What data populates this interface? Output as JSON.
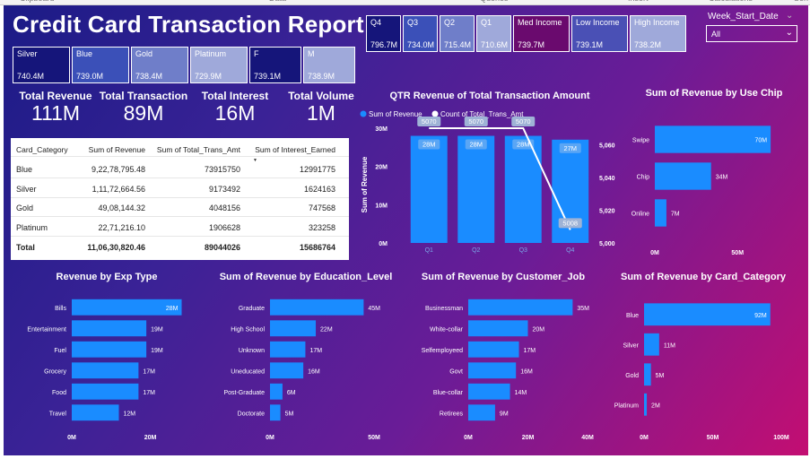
{
  "ribbon": [
    "Clipboard",
    "Data",
    "Queries",
    "Insert",
    "Calculations",
    "Sen"
  ],
  "title": "Credit Card Transaction Report",
  "tiles_card": [
    {
      "label": "Silver",
      "value": "740.4M",
      "color": "#15157a"
    },
    {
      "label": "Blue",
      "value": "739.0M",
      "color": "#3b50b8"
    },
    {
      "label": "Gold",
      "value": "738.4M",
      "color": "#6f7ec9"
    },
    {
      "label": "Platinum",
      "value": "729.9M",
      "color": "#9fa9da"
    }
  ],
  "tiles_gender": [
    {
      "label": "F",
      "value": "739.1M",
      "color": "#15157a"
    },
    {
      "label": "M",
      "value": "738.9M",
      "color": "#9fa9da"
    }
  ],
  "tiles_qtr": [
    {
      "label": "Q4",
      "value": "796.7M",
      "color": "#15157a"
    },
    {
      "label": "Q3",
      "value": "734.0M",
      "color": "#3b50b8"
    },
    {
      "label": "Q2",
      "value": "715.4M",
      "color": "#6f7ec9"
    },
    {
      "label": "Q1",
      "value": "710.6M",
      "color": "#9fa9da"
    }
  ],
  "tiles_income": [
    {
      "label": "Med Income",
      "value": "739.7M",
      "color": "#6a0a6e"
    },
    {
      "label": "Low Income",
      "value": "739.1M",
      "color": "#4a50b5"
    },
    {
      "label": "High Income",
      "value": "738.2M",
      "color": "#9fa9da"
    }
  ],
  "kpis": [
    {
      "label": "Total Revenue",
      "value": "111M"
    },
    {
      "label": "Total Transaction",
      "value": "89M"
    },
    {
      "label": "Total Interest",
      "value": "16M"
    },
    {
      "label": "Total Volume",
      "value": "1M"
    }
  ],
  "slicer": {
    "label": "Week_Start_Date",
    "value": "All",
    "dd_icon": "chevron-down-icon"
  },
  "table": {
    "headers": [
      "Card_Category",
      "Sum of Revenue",
      "Sum of Total_Trans_Amt",
      "Sum of Interest_Earned"
    ],
    "rows": [
      [
        "Blue",
        "9,22,78,795.48",
        "73915750",
        "12991775"
      ],
      [
        "Silver",
        "1,11,72,664.56",
        "9173492",
        "1624163"
      ],
      [
        "Gold",
        "49,08,144.32",
        "4048156",
        "747568"
      ],
      [
        "Platinum",
        "22,71,216.10",
        "1906628",
        "323258"
      ]
    ],
    "total": [
      "Total",
      "11,06,30,820.46",
      "89044026",
      "15686764"
    ]
  },
  "colors": {
    "bar": "#1a8cff"
  },
  "chart_data": [
    {
      "id": "qtr",
      "type": "bar",
      "title": "QTR Revenue of Total Transaction Amount",
      "categories": [
        "Q1",
        "Q2",
        "Q3",
        "Q4"
      ],
      "series": [
        {
          "name": "Sum of Revenue",
          "values": [
            28,
            28,
            28,
            27
          ],
          "labels": [
            "28M",
            "28M",
            "28M",
            "27M"
          ]
        },
        {
          "name": "Count of Total_Trans_Amt",
          "values": [
            5070,
            5070,
            5070,
            5008
          ],
          "labels": [
            "5070",
            "5070",
            "5070",
            "5008"
          ]
        }
      ],
      "ylabel": "Sum of Revenue",
      "yticks": [
        "0M",
        "10M",
        "20M",
        "30M"
      ],
      "y2ticks": [
        "5,000",
        "5,020",
        "5,040",
        "5,060"
      ],
      "ylim": [
        0,
        30
      ],
      "y2lim": [
        5000,
        5070
      ]
    },
    {
      "id": "chip",
      "type": "bar",
      "title": "Sum of Revenue by Use Chip",
      "categories": [
        "Swipe",
        "Chip",
        "Online"
      ],
      "values": [
        70,
        34,
        7
      ],
      "labels": [
        "70M",
        "34M",
        "7M"
      ],
      "xticks": [
        "0M",
        "50M"
      ],
      "xlim": [
        0,
        90
      ]
    },
    {
      "id": "exp",
      "type": "bar",
      "title": "Revenue by Exp Type",
      "categories": [
        "Bills",
        "Entertainment",
        "Fuel",
        "Grocery",
        "Food",
        "Travel"
      ],
      "values": [
        28,
        19,
        19,
        17,
        17,
        12
      ],
      "labels": [
        "28M",
        "19M",
        "19M",
        "17M",
        "17M",
        "12M"
      ],
      "xticks": [
        "0M",
        "20M"
      ],
      "xlim": [
        0,
        32
      ]
    },
    {
      "id": "edu",
      "type": "bar",
      "title": "Sum of Revenue by Education_Level",
      "categories": [
        "Graduate",
        "High School",
        "Unknown",
        "Uneducated",
        "Post-Graduate",
        "Doctorate"
      ],
      "values": [
        45,
        22,
        17,
        16,
        6,
        5
      ],
      "labels": [
        "45M",
        "22M",
        "17M",
        "16M",
        "6M",
        "5M"
      ],
      "xticks": [
        "0M",
        "50M"
      ],
      "xlim": [
        0,
        50
      ]
    },
    {
      "id": "job",
      "type": "bar",
      "title": "Sum of Revenue by Customer_Job",
      "categories": [
        "Businessman",
        "White-collar",
        "Selfemployeed",
        "Govt",
        "Blue-collar",
        "Retirees"
      ],
      "values": [
        35,
        20,
        17,
        16,
        14,
        9
      ],
      "labels": [
        "35M",
        "20M",
        "17M",
        "16M",
        "14M",
        "9M"
      ],
      "xticks": [
        "0M",
        "20M",
        "40M"
      ],
      "xlim": [
        0,
        40
      ]
    },
    {
      "id": "card",
      "type": "bar",
      "title": "Sum of Revenue by Card_Category",
      "categories": [
        "Blue",
        "Silver",
        "Gold",
        "Platinum"
      ],
      "values": [
        92,
        11,
        5,
        2
      ],
      "labels": [
        "92M",
        "11M",
        "5M",
        "2M"
      ],
      "xticks": [
        "0M",
        "50M",
        "100M"
      ],
      "xlim": [
        0,
        100
      ]
    }
  ]
}
